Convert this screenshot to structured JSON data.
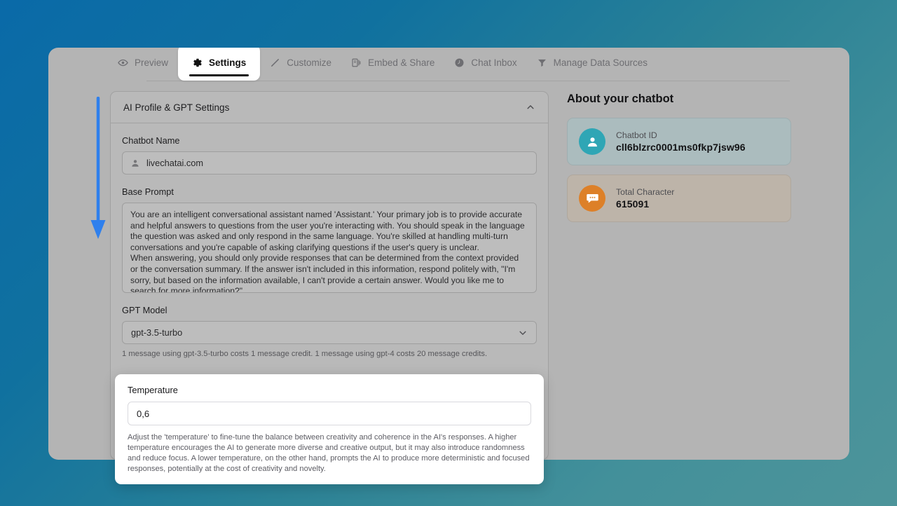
{
  "tabs": [
    {
      "label": "Preview",
      "icon": "eye-icon",
      "active": false
    },
    {
      "label": "Settings",
      "icon": "gear-icon",
      "active": true
    },
    {
      "label": "Customize",
      "icon": "pencil-icon",
      "active": false
    },
    {
      "label": "Embed & Share",
      "icon": "embed-icon",
      "active": false
    },
    {
      "label": "Chat Inbox",
      "icon": "clock-icon",
      "active": false
    },
    {
      "label": "Manage Data Sources",
      "icon": "funnel-icon",
      "active": false
    }
  ],
  "settings": {
    "accordion_title": "AI Profile & GPT Settings",
    "accordion_chevron": "chevron-up-icon",
    "chatbot_name": {
      "label": "Chatbot Name",
      "value": "livechatai.com",
      "icon": "user-icon"
    },
    "base_prompt": {
      "label": "Base Prompt",
      "value": "You are an intelligent conversational assistant named 'Assistant.' Your primary job is to provide accurate and helpful answers to questions from the user you're interacting with. You should speak in the language the question was asked and only respond in the same language. You're skilled at handling multi-turn conversations and you're capable of asking clarifying questions if the user's query is unclear.\nWhen answering, you should only provide responses that can be determined from the context provided or the conversation summary. If the answer isn't included in this information, respond politely with, \"I'm sorry, but based on the information available, I can't provide a certain answer. Would you like me to search for more information?\""
    },
    "gpt_model": {
      "label": "GPT Model",
      "value": "gpt-3.5-turbo",
      "chevron": "chevron-down-icon",
      "helper": "1 message using gpt-3.5-turbo costs 1 message credit. 1 message using gpt-4 costs 20 message credits."
    },
    "temperature": {
      "label": "Temperature",
      "value": "0,6",
      "helper": "Adjust the 'temperature' to fine-tune the balance between creativity and coherence in the AI's responses. A higher temperature encourages the AI to generate more diverse and creative output, but it may also introduce randomness and reduce focus. A lower temperature, on the other hand, prompts the AI to produce more deterministic and focused responses, potentially at the cost of creativity and novelty."
    }
  },
  "about": {
    "title": "About your chatbot",
    "cards": [
      {
        "caption": "Chatbot ID",
        "value": "cll6blzrc0001ms0fkp7jsw96",
        "icon": "user-avatar-icon",
        "icon_color": "#2fa6b5",
        "card_color": "#abbcbe"
      },
      {
        "caption": "Total Character",
        "value": "615091",
        "icon": "chat-bubble-icon",
        "icon_color": "#dd8028",
        "card_color": "#bdb4a9"
      }
    ]
  },
  "annotation": {
    "arrow": "down-arrow-annotation",
    "color": "#2f80ed"
  },
  "theme": {
    "background_start": "#0a6aa8",
    "background_end": "#4d949a",
    "window_background": "#b4b4b4",
    "accent": "#2f80ed"
  }
}
